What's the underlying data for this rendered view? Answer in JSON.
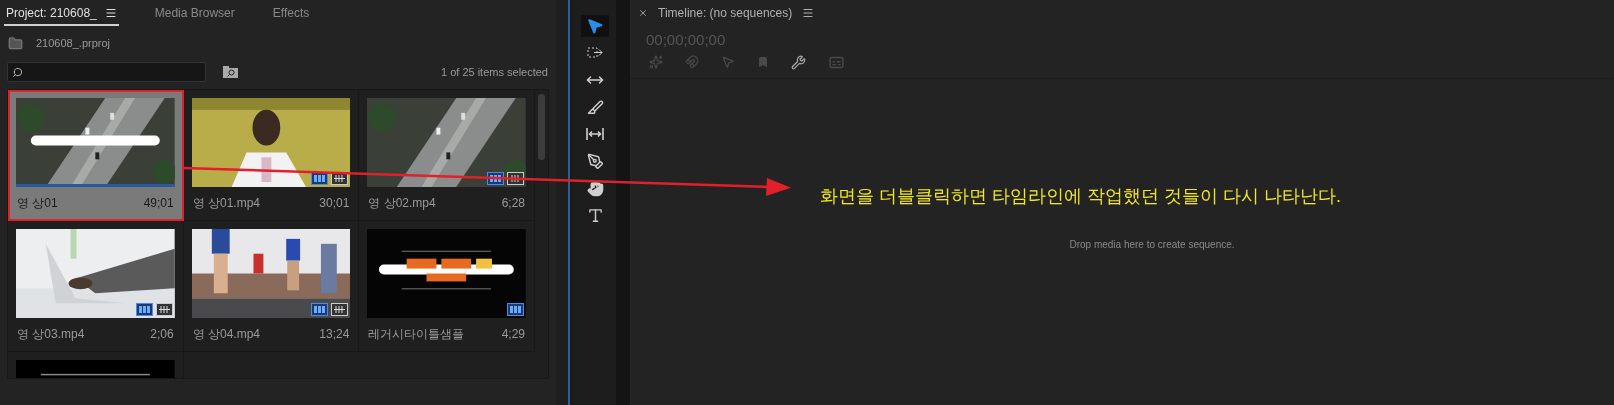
{
  "project_panel": {
    "tabs": [
      {
        "label": "Project: 210608_",
        "selected": true,
        "menu": true
      },
      {
        "label": "Media Browser",
        "selected": false,
        "menu": false
      },
      {
        "label": "Effects",
        "selected": false,
        "menu": false
      }
    ],
    "path": "210608_.prproj",
    "status": "1 of 25 items selected",
    "items": [
      {
        "name": "영 상01",
        "duration": "49;01",
        "selected": true,
        "video": false,
        "audio": false
      },
      {
        "name": "영 상01.mp4",
        "duration": "30;01",
        "selected": false,
        "video": true,
        "audio": true
      },
      {
        "name": "영 상02.mp4",
        "duration": "6;28",
        "selected": false,
        "video": true,
        "audio": true
      },
      {
        "name": "영 상03.mp4",
        "duration": "2;06",
        "selected": false,
        "video": true,
        "audio": true
      },
      {
        "name": "영 상04.mp4",
        "duration": "13;24",
        "selected": false,
        "video": true,
        "audio": true
      },
      {
        "name": "레거시타이틀샘플",
        "duration": "4;29",
        "selected": false,
        "video": true,
        "audio": false
      },
      {
        "selected": false
      }
    ]
  },
  "tools": [
    {
      "kind": "selection",
      "selected": true
    },
    {
      "kind": "track-select",
      "selected": false
    },
    {
      "kind": "ripple",
      "selected": false
    },
    {
      "kind": "razor",
      "selected": false
    },
    {
      "kind": "slip",
      "selected": false
    },
    {
      "kind": "pen",
      "selected": false
    },
    {
      "kind": "hand",
      "selected": false
    },
    {
      "kind": "type",
      "selected": false
    }
  ],
  "timeline": {
    "title": "Timeline: (no sequences)",
    "timecode": "00;00;00;00",
    "empty_hint": "Drop media here to create sequence."
  },
  "annotation": "화면을 더블클릭하면 타임라인에 작업했던 것들이 다시 나타난다."
}
